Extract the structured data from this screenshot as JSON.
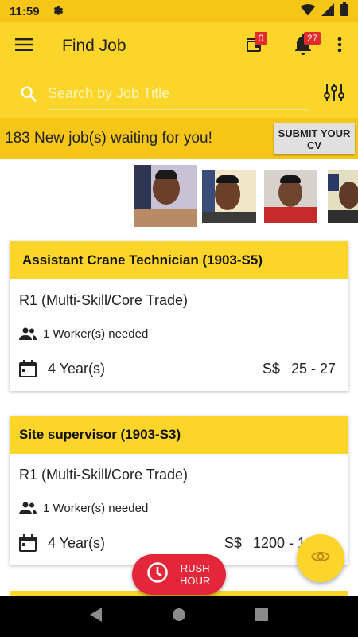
{
  "status_bar": {
    "time": "11:59",
    "icons": [
      "gear-icon",
      "wifi-icon",
      "cellular-icon",
      "battery-icon"
    ]
  },
  "app_bar": {
    "title": "Find Job",
    "wallet_badge": "0",
    "notification_badge": "27",
    "icons": [
      "menu-icon",
      "wallet-icon",
      "bell-icon",
      "more-vert-icon"
    ]
  },
  "search": {
    "placeholder": "Search by Job Title",
    "value": "",
    "icons": [
      "search-icon",
      "filter-sliders-icon"
    ]
  },
  "promo": {
    "message": "183 New job(s) waiting for you!",
    "cv_button_label": "SUBMIT YOUR CV"
  },
  "jobs": [
    {
      "title": "Assistant Crane Technician (1903-S5)",
      "trade": "R1 (Multi-Skill/Core Trade)",
      "workers": "1 Worker(s) needed",
      "experience": "4 Year(s)",
      "currency": "S$",
      "salary": "25 - 27"
    },
    {
      "title": "Site supervisor (1903-S3)",
      "trade": "R1 (Multi-Skill/Core Trade)",
      "workers": "1 Worker(s) needed",
      "experience": "4 Year(s)",
      "currency": "S$",
      "salary": "1200 - 1"
    }
  ],
  "rush_hour": {
    "label_line1": "RUSH",
    "label_line2": "HOUR"
  },
  "colors": {
    "primary_yellow": "#fbd52a",
    "status_yellow": "#f5c518",
    "badge_red": "#e32b2b",
    "rush_red": "#e3263a"
  }
}
